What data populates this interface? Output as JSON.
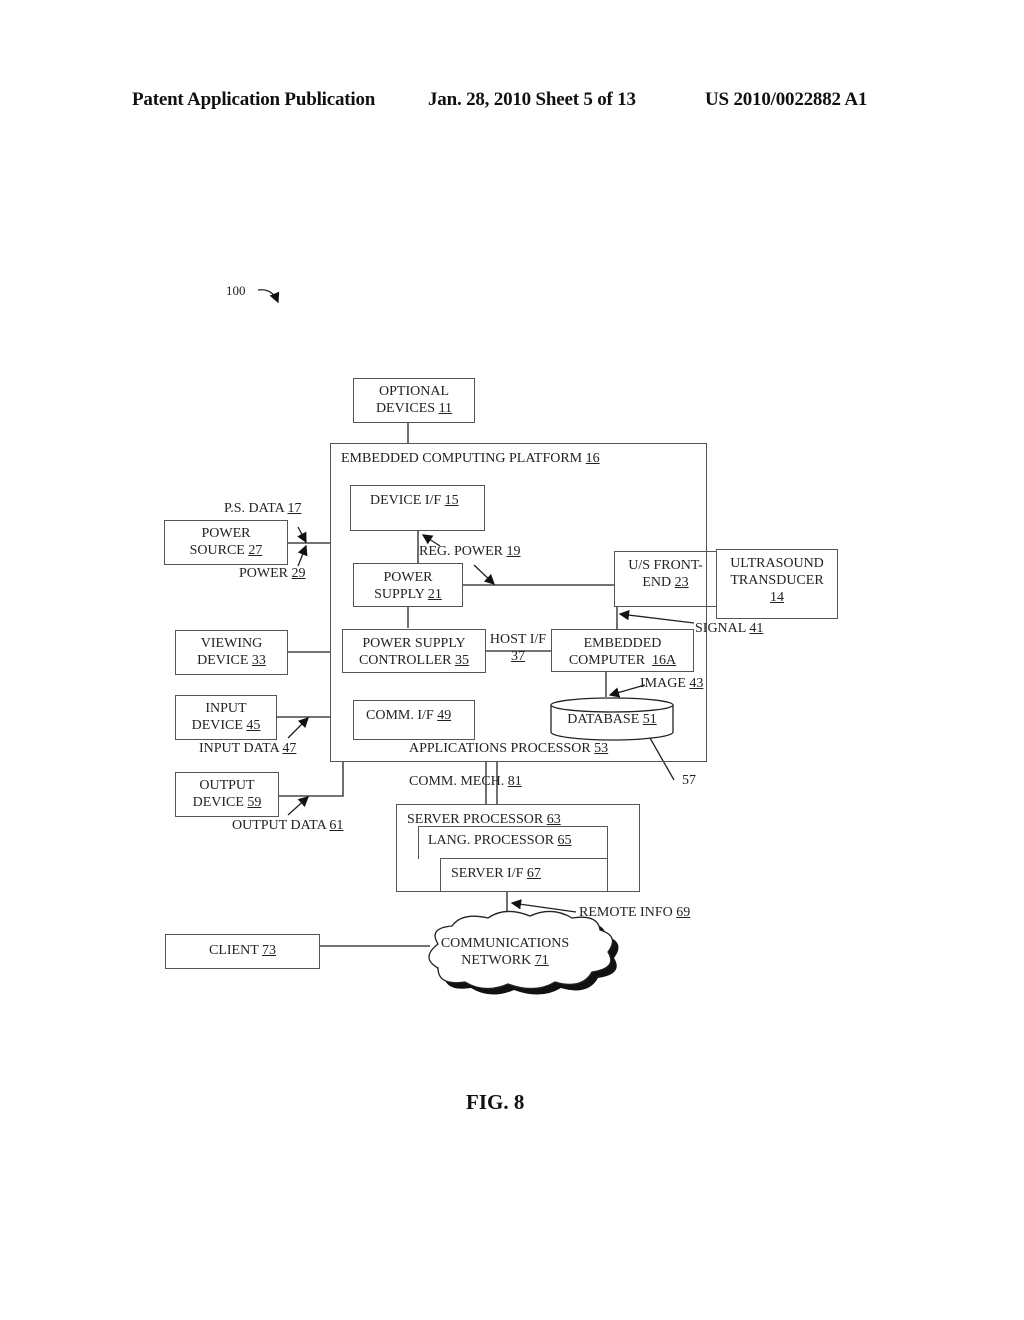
{
  "header": {
    "left": "Patent Application Publication",
    "middle": "Jan. 28, 2010  Sheet 5 of 13",
    "right": "US 2010/0022882 A1"
  },
  "figure_ref": "100",
  "figure_caption": "FIG. 8",
  "blocks": {
    "optional_devices": {
      "line1": "OPTIONAL",
      "line2": "DEVICES",
      "num": "11"
    },
    "platform": {
      "text": "EMBEDDED COMPUTING PLATFORM",
      "num": "16"
    },
    "device_if": {
      "text": "DEVICE I/F",
      "num": "15"
    },
    "power_source": {
      "line1": "POWER",
      "line2": "SOURCE",
      "num": "27"
    },
    "power_supply": {
      "line1": "POWER",
      "line2": "SUPPLY",
      "num": "21"
    },
    "us_front_end": {
      "line1": "U/S FRONT-",
      "line2": "END",
      "num": "23"
    },
    "ultrasound_transducer": {
      "line1": "ULTRASOUND",
      "line2": "TRANSDUCER",
      "num": "14"
    },
    "viewing_device": {
      "line1": "VIEWING",
      "line2": "DEVICE",
      "num": "33"
    },
    "ps_controller": {
      "line1": "POWER SUPPLY",
      "line2": "CONTROLLER",
      "num": "35"
    },
    "embedded_computer": {
      "line1": "EMBEDDED",
      "line2": "COMPUTER",
      "num": "16A"
    },
    "input_device": {
      "line1": "INPUT",
      "line2": "DEVICE",
      "num": "45"
    },
    "comm_if": {
      "text": "COMM.  I/F",
      "num": "49"
    },
    "database": {
      "text": "DATABASE",
      "num": "51"
    },
    "apps_processor": {
      "text": "APPLICATIONS PROCESSOR",
      "num": "53"
    },
    "output_device": {
      "line1": "OUTPUT",
      "line2": "DEVICE",
      "num": "59"
    },
    "server_processor": {
      "text": "SERVER PROCESSOR",
      "num": "63"
    },
    "lang_processor": {
      "text": "LANG. PROCESSOR",
      "num": "65"
    },
    "server_if": {
      "text": "SERVER I/F",
      "num": "67"
    },
    "client": {
      "text": "CLIENT",
      "num": "73"
    },
    "comm_network": {
      "line1": "COMMUNICATIONS",
      "line2": "NETWORK",
      "num": "71"
    }
  },
  "signals": {
    "ps_data": {
      "text": "P.S. DATA",
      "num": "17"
    },
    "power": {
      "text": "POWER",
      "num": "29"
    },
    "reg_power": {
      "text": "REG. POWER",
      "num": "19"
    },
    "signal": {
      "text": "SIGNAL",
      "num": "41"
    },
    "host_if": {
      "text": "HOST I/F",
      "num": "37"
    },
    "image": {
      "text": "IMAGE",
      "num": "43"
    },
    "input_data": {
      "text": "INPUT DATA",
      "num": "47"
    },
    "output_data": {
      "text": "OUTPUT DATA",
      "num": "61"
    },
    "comm_mech": {
      "text": "COMM. MECH.",
      "num": "81"
    },
    "ref_57": "57",
    "remote_info": {
      "text": "REMOTE INFO",
      "num": "69"
    }
  }
}
